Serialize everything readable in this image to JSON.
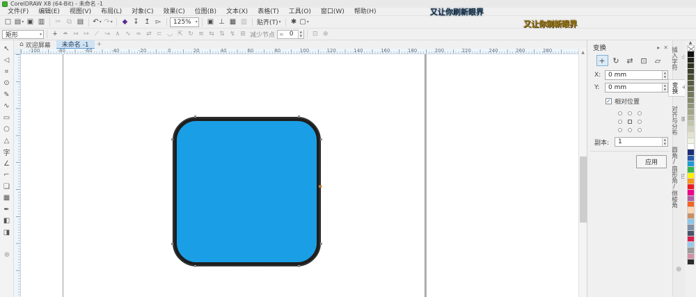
{
  "window": {
    "title": "CorelDRAW X8 (64-Bit) - 未命名 -1"
  },
  "watermarks": {
    "top": "又让你刷新眼界",
    "gold": "又让你刷新眼界"
  },
  "menus": [
    {
      "label": "文件(F)"
    },
    {
      "label": "编辑(E)"
    },
    {
      "label": "视图(V)"
    },
    {
      "label": "布局(L)"
    },
    {
      "label": "对象(C)"
    },
    {
      "label": "效果(C)"
    },
    {
      "label": "位图(B)"
    },
    {
      "label": "文本(X)"
    },
    {
      "label": "表格(T)"
    },
    {
      "label": "工具(O)"
    },
    {
      "label": "窗口(W)"
    },
    {
      "label": "帮助(H)"
    }
  ],
  "toolbar": {
    "file_group": [
      {
        "name": "new-document-button",
        "glyph": "□"
      },
      {
        "name": "open-button",
        "glyph": "▤",
        "dd": true
      },
      {
        "name": "save-button",
        "glyph": "▣"
      },
      {
        "name": "print-button",
        "glyph": "▥"
      }
    ],
    "edit_group": [
      {
        "name": "cut-button",
        "glyph": "✂",
        "dim": true
      },
      {
        "name": "copy-button",
        "glyph": "⧉",
        "dim": true
      },
      {
        "name": "paste-button",
        "glyph": "▤"
      }
    ],
    "undo_group": [
      {
        "name": "undo-button",
        "glyph": "↶",
        "dd": true
      },
      {
        "name": "redo-button",
        "glyph": "↷",
        "dd": true,
        "dim": true
      }
    ],
    "content_group": [
      {
        "name": "search-content-button",
        "glyph": "◆",
        "color": "#5b2d8e"
      },
      {
        "name": "import-button",
        "glyph": "↧"
      },
      {
        "name": "export-button",
        "glyph": "↥"
      },
      {
        "name": "publish-pdf-button",
        "glyph": "▻"
      }
    ],
    "zoom_level": "125%",
    "view_group": [
      {
        "name": "full-screen-preview-button",
        "glyph": "▣"
      },
      {
        "name": "show-rulers-button",
        "glyph": "⊥"
      },
      {
        "name": "show-grid-button",
        "glyph": "▦"
      },
      {
        "name": "show-guidelines-button",
        "glyph": "▥",
        "dim": true
      }
    ],
    "snap_label": "贴齐(T)",
    "options_glyph": "✱",
    "launcher_glyph": "▢"
  },
  "property_bar": {
    "selection_mode": "矩形",
    "node_icons": [
      {
        "name": "add-node-button",
        "glyph": "∔",
        "on": true
      },
      {
        "name": "delete-node-button",
        "glyph": "∸",
        "on": true
      },
      {
        "name": "join-nodes-button",
        "glyph": "↣"
      },
      {
        "name": "break-curve-button",
        "glyph": "↦"
      },
      {
        "name": "convert-to-line-button",
        "glyph": "⟋"
      },
      {
        "name": "convert-to-curve-button",
        "glyph": "↝"
      },
      {
        "name": "cusp-node-button",
        "glyph": "∧"
      },
      {
        "name": "smooth-node-button",
        "glyph": "∿"
      },
      {
        "name": "symmetrical-node-button",
        "glyph": "≈"
      },
      {
        "name": "reverse-direction-button",
        "glyph": "⇄"
      },
      {
        "name": "extract-subpath-button",
        "glyph": "⊂"
      },
      {
        "name": "close-curve-button",
        "glyph": "◡"
      },
      {
        "name": "stretch-nodes-button",
        "glyph": "⇱"
      },
      {
        "name": "rotate-skew-nodes-button",
        "glyph": "↻"
      },
      {
        "name": "align-nodes-button",
        "glyph": "≡"
      },
      {
        "name": "reflect-horizontal-button",
        "glyph": "⇆"
      },
      {
        "name": "reflect-vertical-button",
        "glyph": "⇅"
      },
      {
        "name": "elastic-mode-button",
        "glyph": "↯"
      },
      {
        "name": "select-all-nodes-button",
        "glyph": "⊞"
      }
    ],
    "reduce_nodes_label": "减少节点",
    "smoothness_value": "0",
    "tail_icons": [
      {
        "name": "curve-smoothness-button",
        "glyph": "⊡"
      },
      {
        "name": "sculpt-button",
        "glyph": "⊕"
      }
    ]
  },
  "tabs": {
    "welcome": "欢迎屏幕",
    "document": "未命名 -1",
    "new_tab": "+"
  },
  "toolbox": [
    {
      "name": "pick-tool",
      "glyph": "↖"
    },
    {
      "name": "shape-tool",
      "glyph": "◁"
    },
    {
      "name": "crop-tool",
      "glyph": "⌗"
    },
    {
      "name": "zoom-tool",
      "glyph": "⊙"
    },
    {
      "name": "freehand-tool",
      "glyph": "✎"
    },
    {
      "name": "artistic-media-tool",
      "glyph": "∿"
    },
    {
      "name": "rectangle-tool",
      "glyph": "▭"
    },
    {
      "name": "ellipse-tool",
      "glyph": "○"
    },
    {
      "name": "polygon-tool",
      "glyph": "△"
    },
    {
      "name": "text-tool",
      "glyph": "字"
    },
    {
      "name": "dimension-tool",
      "glyph": "∠"
    },
    {
      "name": "connector-tool",
      "glyph": "⌐"
    },
    {
      "name": "drop-shadow-tool",
      "glyph": "❏"
    },
    {
      "name": "transparency-tool",
      "glyph": "▦"
    },
    {
      "name": "color-eyedropper-tool",
      "glyph": "✒"
    },
    {
      "name": "interactive-fill-tool",
      "glyph": "◧"
    },
    {
      "name": "smart-fill-tool",
      "glyph": "◨"
    }
  ],
  "ruler": {
    "labels": [
      "-100",
      "-80",
      "-60",
      "-40",
      "-20",
      "0",
      "20",
      "40",
      "60",
      "80",
      "100",
      "120",
      "140",
      "160",
      "180",
      "200",
      "220",
      "240",
      "260",
      "280"
    ]
  },
  "canvas": {
    "shape_fill": "#1A9FE6",
    "shape_stroke": "#1E1E1E"
  },
  "docker": {
    "title": "变换",
    "collapse_glyph": "▸",
    "close_glyph": "✕",
    "transform_icons": [
      {
        "name": "transform-position-button",
        "glyph": "+",
        "active": true
      },
      {
        "name": "transform-rotate-button",
        "glyph": "↻"
      },
      {
        "name": "transform-scale-mirror-button",
        "glyph": "⇄"
      },
      {
        "name": "transform-size-button",
        "glyph": "⊡"
      },
      {
        "name": "transform-skew-button",
        "glyph": "▱"
      }
    ],
    "x_label": "X:",
    "x_value": "0 mm",
    "y_label": "Y:",
    "y_value": "0 mm",
    "relative_label": "相对位置",
    "copies_label": "副本:",
    "copies_value": "1",
    "apply_label": "应用"
  },
  "docker_tabs": [
    {
      "label": "插入字符",
      "icon": "☆"
    },
    {
      "label": "变换",
      "icon": "+",
      "active": true
    },
    {
      "label": "对齐与分布",
      "icon": "⊞"
    },
    {
      "label": "圆角/扇形角/倒棱角",
      "icon": "◰"
    }
  ],
  "palette": {
    "colors": [
      "none",
      "#111111",
      "#23261b",
      "#2f3320",
      "#3c402a",
      "#4a4e35",
      "#585c41",
      "#67694e",
      "#75785c",
      "#84876b",
      "#93967a",
      "#a3a58a",
      "#b2b49a",
      "#c2c4ab",
      "#d2d3bd",
      "#e2e3cf",
      "#f1f1e2",
      "#ffffff",
      "#1b2d76",
      "#2b5cab",
      "#1d9bd6",
      "#39b54a",
      "#fff200",
      "#f7941d",
      "#ed1c24",
      "#ec008c",
      "#b05fa6",
      "#f26522",
      "#fbd7b5",
      "#c98f65",
      "#8cc6e8",
      "#8090a8",
      "#44546a",
      "#d6204e",
      "#99c9ea",
      "#9b9b9b",
      "#d490a8",
      "#2b2b2b"
    ]
  }
}
